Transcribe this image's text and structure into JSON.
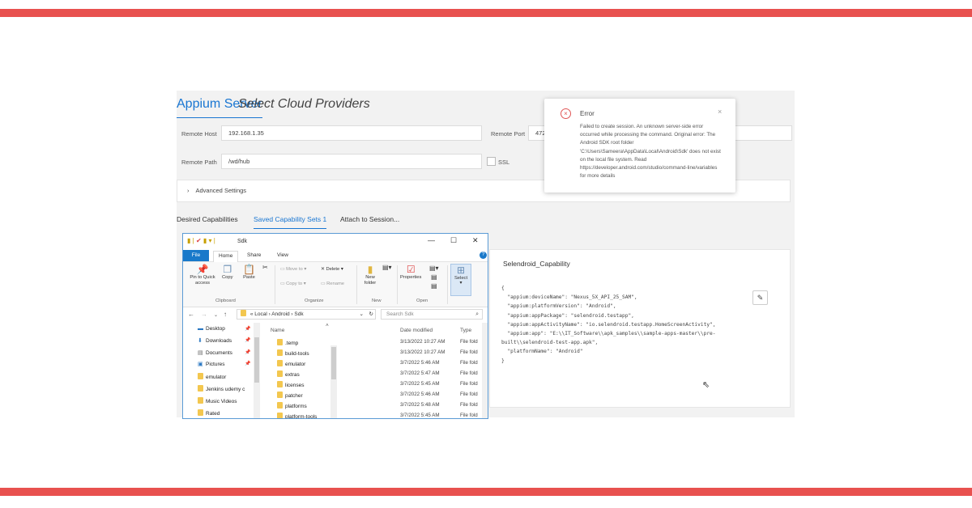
{
  "colors": {
    "accent_bar": "#e8514f",
    "link_blue": "#1976d2",
    "error_red": "#e05555",
    "file_tab_blue": "#1979ca"
  },
  "appium": {
    "tabs": [
      "Appium Server",
      "Select Cloud Providers"
    ],
    "remote_host_label": "Remote Host",
    "remote_host_value": "192.168.1.35",
    "remote_port_label": "Remote Port",
    "remote_port_value": "472",
    "remote_path_label": "Remote Path",
    "remote_path_value": "/wd/hub",
    "ssl_label": "SSL",
    "advanced_settings": "Advanced Settings",
    "session_tabs": [
      "Desired Capabilities",
      "Saved Capability Sets 1",
      "Attach to Session..."
    ],
    "capability_title": "Selendroid_Capability",
    "capability_json": [
      "{",
      "  \"appium:deviceName\": \"Nexus_5X_API_25_SAM\",",
      "  \"appium:platformVersion\": \"Android\",",
      "  \"appium:appPackage\": \"selendroid.testapp\",",
      "  \"appium:appActivityName\": \"io.selendroid.testapp.HomeScreenActivity\",",
      "  \"appium:app\": \"E:\\\\IT_Software\\\\apk_samples\\\\sample-apps-master\\\\pre-",
      "built\\\\selendroid-test-app.apk\",",
      "  \"platformName\": \"Android\"",
      "}"
    ],
    "edit_icon": "pencil-icon"
  },
  "error": {
    "title": "Error",
    "close": "×",
    "message": "Failed to create session. An unknown server-side error occurred while processing the command. Original error: The Android SDK root folder 'C:\\Users\\Sameera\\AppData\\Local\\Android\\Sdk' does not exist on the local file system. Read https://developer.android.com/studio/command-line/variables for more details"
  },
  "explorer": {
    "title": "Sdk",
    "ribbon_tabs": [
      "File",
      "Home",
      "Share",
      "View"
    ],
    "clipboard": {
      "pin": "Pin to Quick access",
      "copy": "Copy",
      "paste": "Paste",
      "group": "Clipboard"
    },
    "organize": {
      "move_to": "Move to",
      "copy_to": "Copy to",
      "delete": "Delete",
      "rename": "Rename",
      "group": "Organize"
    },
    "new": {
      "folder": "New folder",
      "group": "New"
    },
    "open": {
      "properties": "Properties",
      "group": "Open"
    },
    "select": {
      "label": "Select"
    },
    "path": [
      "«",
      "Local",
      "Android",
      "Sdk"
    ],
    "search_placeholder": "Search Sdk",
    "nav_items": [
      "Desktop",
      "Downloads",
      "Documents",
      "Pictures",
      "emulator",
      "Jenkins udemy c",
      "Music Videos",
      "Rated"
    ],
    "columns": {
      "name": "Name",
      "date": "Date modified",
      "type": "Type"
    },
    "files": [
      {
        "name": ".temp",
        "date": "3/13/2022 10:27 AM",
        "type": "File fold"
      },
      {
        "name": "build-tools",
        "date": "3/13/2022 10:27 AM",
        "type": "File fold"
      },
      {
        "name": "emulator",
        "date": "3/7/2022 5:46 AM",
        "type": "File fold"
      },
      {
        "name": "extras",
        "date": "3/7/2022 5:47 AM",
        "type": "File fold"
      },
      {
        "name": "licenses",
        "date": "3/7/2022 5:45 AM",
        "type": "File fold"
      },
      {
        "name": "patcher",
        "date": "3/7/2022 5:46 AM",
        "type": "File fold"
      },
      {
        "name": "platforms",
        "date": "3/7/2022 5:48 AM",
        "type": "File fold"
      },
      {
        "name": "platform-tools",
        "date": "3/7/2022 5:45 AM",
        "type": "File fold"
      }
    ]
  }
}
